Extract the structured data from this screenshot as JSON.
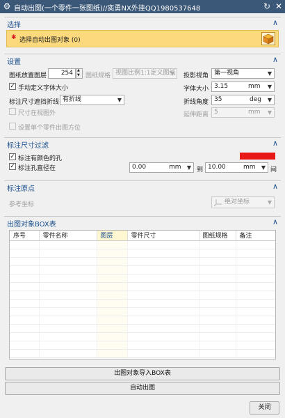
{
  "window": {
    "title": "自动出图(一个零件一张图纸)//奕勇NX外挂QQ1980537648",
    "gear_icon": "gear-icon",
    "refresh_icon": "refresh-icon",
    "close_icon": "close-icon"
  },
  "select": {
    "header": "选择",
    "required_mark": "✱",
    "item_label": "选择自动出图对象 (0)",
    "item_bg": "#fbd97c",
    "cube_icon": "cube-icon"
  },
  "settings": {
    "header": "设置",
    "layer_label": "图纸放置图层",
    "layer_value": "254",
    "spin_up": "▲",
    "spin_down": "▼",
    "sheet_spec_label": "图纸规格",
    "sheet_spec_value": "视图比例1:1定义图纸",
    "projection_label": "投影视角",
    "projection_value": "第一视角",
    "manual_font_label": "手动定义字体大小",
    "manual_font_checked": true,
    "font_size_label": "字体大小",
    "font_size_value": "3.15",
    "font_size_unit": "mm",
    "leader_label": "标注尺寸遮挡折线",
    "leader_value": "有折线",
    "angle_label": "折线角度",
    "angle_value": "35",
    "angle_unit": "deg",
    "outside_view_label": "尺寸在视图外",
    "outside_view_checked": false,
    "extend_label": "延伸距离",
    "extend_value": "5",
    "extend_unit": "mm",
    "single_part_label": "设置单个零件出图方位",
    "single_part_checked": false
  },
  "filter": {
    "header": "标注尺寸过滤",
    "colored_hole_label": "标注有颜色的孔",
    "colored_hole_checked": true,
    "color_swatch": "#e8171a",
    "hole_dia_label": "标注孔直径在",
    "hole_dia_checked": true,
    "min_value": "0.00",
    "min_unit": "mm",
    "to_label": "到",
    "max_value": "10.00",
    "max_unit": "mm",
    "between_label": "间"
  },
  "origin": {
    "header": "标注原点",
    "ref_label": "参考坐标",
    "coord_value": "绝对坐标",
    "csys_icon": "csys-icon"
  },
  "box_table": {
    "header": "出图对象BOX表",
    "columns": [
      "序号",
      "零件名称",
      "图层",
      "零件尺寸",
      "图纸规格",
      "备注"
    ],
    "rows": []
  },
  "actions": {
    "import_label": "出图对象导入BOX表",
    "auto_label": "自动出图",
    "close_label": "关闭"
  },
  "chevron_up": "∧"
}
